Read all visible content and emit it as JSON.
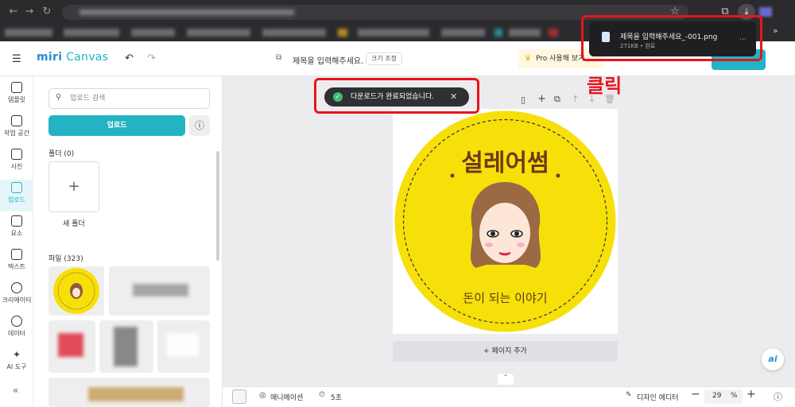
{
  "browser": {
    "nav_icons": [
      "back-icon",
      "forward-icon",
      "reload-icon"
    ],
    "download": {
      "file_name": "제목을 입력해주세요_-001.png",
      "meta": "271KB • 완료"
    }
  },
  "app": {
    "brand_prefix": "miri",
    "brand_suffix": "Canvas",
    "doc_title": "제목을 입력해주세요.",
    "resize_label": "크기 조정",
    "pro_label": "Pro 사용해 보기"
  },
  "rail": {
    "items": [
      {
        "label": "템플릿"
      },
      {
        "label": "작업 공간"
      },
      {
        "label": "사진"
      },
      {
        "label": "업로드"
      },
      {
        "label": "요소"
      },
      {
        "label": "텍스트"
      },
      {
        "label": "크리에이터"
      },
      {
        "label": "데이터"
      },
      {
        "label": "AI 도구"
      }
    ]
  },
  "panel": {
    "search_placeholder": "업로드 검색",
    "upload_label": "업로드",
    "folder_heading": "폴더 (0)",
    "new_folder_label": "새 폴더",
    "files_heading": "파일 (323)"
  },
  "canvas": {
    "sticker_title": "설레어썸",
    "sticker_subtitle": "돈이 되는 이야기",
    "add_page_label": "페이지 추가"
  },
  "bottom": {
    "animation_label": "애니메이션",
    "duration_label": "5초",
    "design_editor_label": "디자인 에디터",
    "zoom_value": "29",
    "zoom_unit": "%"
  },
  "toast": {
    "message": "다운로드가 완료되었습니다."
  },
  "annotation": {
    "click_label": "클릭"
  },
  "ai_button_label": "ai",
  "colors": {
    "brand": "#23b3c3",
    "highlight": "#e8141b",
    "sticker_yellow": "#f7df0a"
  }
}
